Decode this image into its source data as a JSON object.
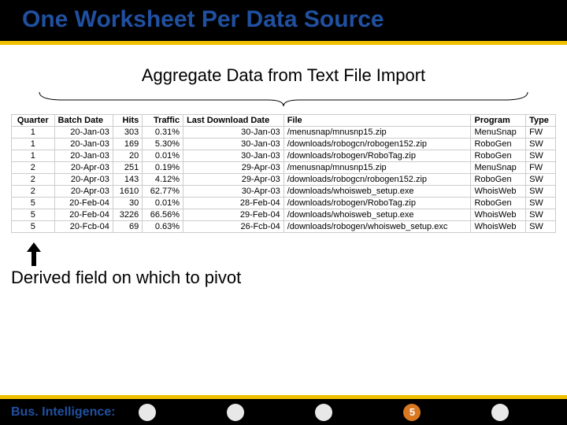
{
  "title": "One Worksheet Per Data Source",
  "subtitle": "Aggregate Data from Text File Import",
  "derived_label": "Derived field on which to pivot",
  "footer_label": "Bus. Intelligence:",
  "page_number": "5",
  "table": {
    "headers": [
      "Quarter",
      "Batch Date",
      "Hits",
      "Traffic",
      "Last Download Date",
      "File",
      "Program",
      "Type"
    ],
    "rows": [
      [
        "1",
        "20-Jan-03",
        "303",
        "0.31%",
        "30-Jan-03",
        "/menusnap/mnusnp15.zip",
        "MenuSnap",
        "FW"
      ],
      [
        "1",
        "20-Jan-03",
        "169",
        "5.30%",
        "30-Jan-03",
        "/downloads/robogcn/robogen152.zip",
        "RoboGen",
        "SW"
      ],
      [
        "1",
        "20-Jan-03",
        "20",
        "0.01%",
        "30-Jan-03",
        "/downloads/robogen/RoboTag.zip",
        "RoboGen",
        "SW"
      ],
      [
        "2",
        "20-Apr-03",
        "251",
        "0.19%",
        "29-Apr-03",
        "/menusnap/mnusnp15.zip",
        "MenuSnap",
        "FW"
      ],
      [
        "2",
        "20-Apr-03",
        "143",
        "4.12%",
        "29-Apr-03",
        "/downloads/robogcn/robogen152.zip",
        "RoboGen",
        "SW"
      ],
      [
        "2",
        "20-Apr-03",
        "1610",
        "62.77%",
        "30-Apr-03",
        "/downloads/whoisweb_setup.exe",
        "WhoisWeb",
        "SW"
      ],
      [
        "5",
        "20-Feb-04",
        "30",
        "0.01%",
        "28-Feb-04",
        "/downloads/robogen/RoboTag.zip",
        "RoboGen",
        "SW"
      ],
      [
        "5",
        "20-Feb-04",
        "3226",
        "66.56%",
        "29-Feb-04",
        "/downloads/whoisweb_setup.exe",
        "WhoisWeb",
        "SW"
      ],
      [
        "5",
        "20-Fcb-04",
        "69",
        "0.63%",
        "26-Fcb-04",
        "/downloads/robogen/whoisweb_setup.exc",
        "WhoisWeb",
        "SW"
      ]
    ]
  }
}
